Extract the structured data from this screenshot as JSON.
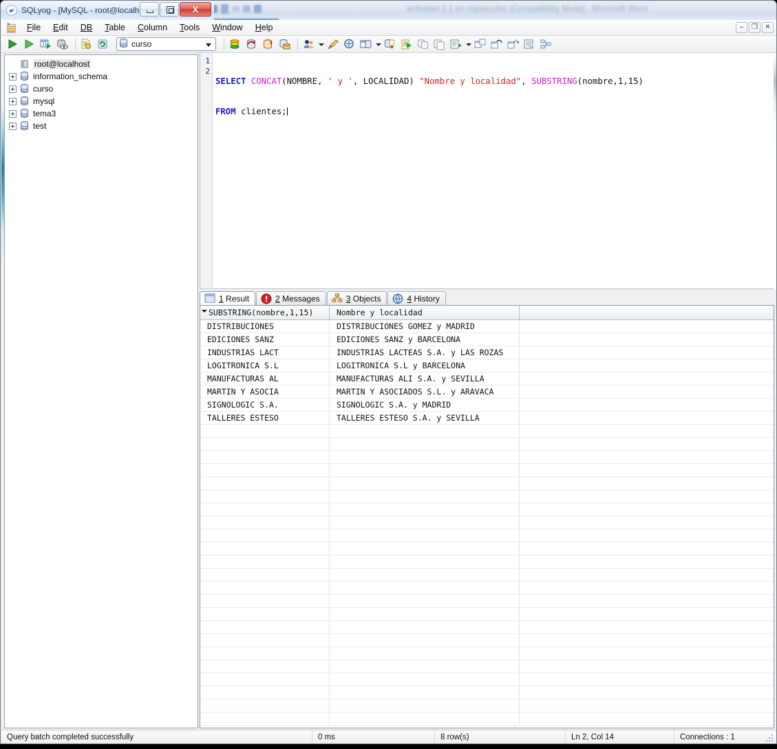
{
  "window": {
    "title": "SQLyog - [MySQL - root@localhost*]",
    "app_icon": "sqlyog-icon",
    "minimize_label": "–",
    "restore_label": "□",
    "close_label": "X",
    "background_window_title": "actividad 1.1 en repaso.doc [Compatibility Mode] - Microsoft Word"
  },
  "mdi": {
    "minimize_label": "–",
    "restore_label": "❐",
    "close_label": "✕"
  },
  "menubar": {
    "icon": "mdi-document-icon",
    "items": [
      {
        "accel": "F",
        "rest": "ile"
      },
      {
        "accel": "E",
        "rest": "dit"
      },
      {
        "accel": "DB",
        "rest": ""
      },
      {
        "accel": "T",
        "rest": "able"
      },
      {
        "accel": "C",
        "rest": "olumn"
      },
      {
        "accel": "T",
        "rest": "ools"
      },
      {
        "accel": "W",
        "rest": "indow"
      },
      {
        "accel": "H",
        "rest": "elp"
      }
    ]
  },
  "toolbar": {
    "database_combo": {
      "value": "curso",
      "icon": "database-icon",
      "arrow": "chevron-down-icon"
    },
    "buttons": [
      "execute-query-icon",
      "execute-all-queries-icon",
      "execute-query-new-tab-icon",
      "explain-query-icon",
      "separator",
      "open-query-icon",
      "refresh-icon",
      "combo",
      "separator",
      "create-database-icon",
      "alter-database-icon",
      "copy-database-icon",
      "backup-database-icon",
      "separator",
      "user-manager-icon",
      "user-manager-arrow",
      "flush-icon",
      "query-builder-icon",
      "schema-designer-icon",
      "schema-designer-arrow",
      "import-external-data-icon",
      "export-icon",
      "copy-table-icon",
      "copy-data-icon",
      "manage-icon",
      "manage-arrow",
      "table-diagnostics-icon",
      "sync-tool-icon",
      "migration-icon",
      "report-icon",
      "relationship-icon"
    ]
  },
  "object_browser": {
    "root": {
      "label": "root@localhost",
      "icon": "server-icon"
    },
    "databases": [
      {
        "label": "information_schema",
        "icon": "database-icon",
        "expander": "plus-icon"
      },
      {
        "label": "curso",
        "icon": "database-icon",
        "expander": "plus-icon"
      },
      {
        "label": "mysql",
        "icon": "database-icon",
        "expander": "plus-icon"
      },
      {
        "label": "tema3",
        "icon": "database-icon",
        "expander": "plus-icon"
      },
      {
        "label": "test",
        "icon": "database-icon",
        "expander": "plus-icon"
      }
    ]
  },
  "editor": {
    "line_numbers": [
      "1",
      "2"
    ],
    "lines": [
      [
        {
          "t": "SELECT ",
          "c": "k"
        },
        {
          "t": "CONCAT",
          "c": "fn"
        },
        {
          "t": "(NOMBRE, ",
          "c": "pl"
        },
        {
          "t": "' y '",
          "c": "st"
        },
        {
          "t": ", LOCALIDAD) ",
          "c": "pl"
        },
        {
          "t": "\"Nombre y localidad\"",
          "c": "st"
        },
        {
          "t": ", ",
          "c": "pl"
        },
        {
          "t": "SUBSTRING",
          "c": "fn"
        },
        {
          "t": "(nombre,1,15)",
          "c": "pl"
        }
      ],
      [
        {
          "t": "FROM ",
          "c": "k"
        },
        {
          "t": "clientes;",
          "c": "pl"
        }
      ]
    ],
    "raw_sql": "SELECT CONCAT(NOMBRE, ' y ', LOCALIDAD) \"Nombre y localidad\", SUBSTRING(nombre,1,15)\nFROM clientes;"
  },
  "result_tabs": [
    {
      "num": "1",
      "label": " Result",
      "icon": "grid-icon",
      "active": true
    },
    {
      "num": "2",
      "label": " Messages",
      "icon": "info-icon",
      "active": false
    },
    {
      "num": "3",
      "label": " Objects",
      "icon": "hierarchy-icon",
      "active": false
    },
    {
      "num": "4",
      "label": " History",
      "icon": "history-icon",
      "active": false
    }
  ],
  "result_grid": {
    "columns": [
      "SUBSTRING(nombre,1,15)",
      "Nombre y localidad",
      ""
    ],
    "sort_indicator_column": 0,
    "rows": [
      [
        "DISTRIBUCIONES",
        "DISTRIBUCIONES GOMEZ y MADRID",
        ""
      ],
      [
        "EDICIONES SANZ",
        "EDICIONES SANZ y BARCELONA",
        ""
      ],
      [
        "INDUSTRIAS LACT",
        "INDUSTRIAS LACTEAS S.A. y LAS ROZAS",
        ""
      ],
      [
        "LOGITRONICA S.L",
        "LOGITRONICA S.L y BARCELONA",
        ""
      ],
      [
        "MANUFACTURAS AL",
        "MANUFACTURAS ALI S.A. y SEVILLA",
        ""
      ],
      [
        "MARTIN Y ASOCIA",
        "MARTIN Y ASOCIADOS S.L. y ARAVACA",
        ""
      ],
      [
        "SIGNOLOGIC S.A.",
        "SIGNOLOGIC S.A. y MADRID",
        ""
      ],
      [
        "TALLERES ESTESO",
        "TALLERES ESTESO S.A. y SEVILLA",
        ""
      ]
    ],
    "empty_row_count": 23
  },
  "statusbar": {
    "message": "Query batch completed successfully",
    "time": "0 ms",
    "rows": "8 row(s)",
    "cursor": "Ln 2, Col 14",
    "connections": "Connections : 1"
  },
  "colors": {
    "keyword": "#1b1bc8",
    "function": "#d61ad6",
    "string": "#e02020",
    "close_button": "#cf3c31",
    "title_text": "#12395e"
  }
}
